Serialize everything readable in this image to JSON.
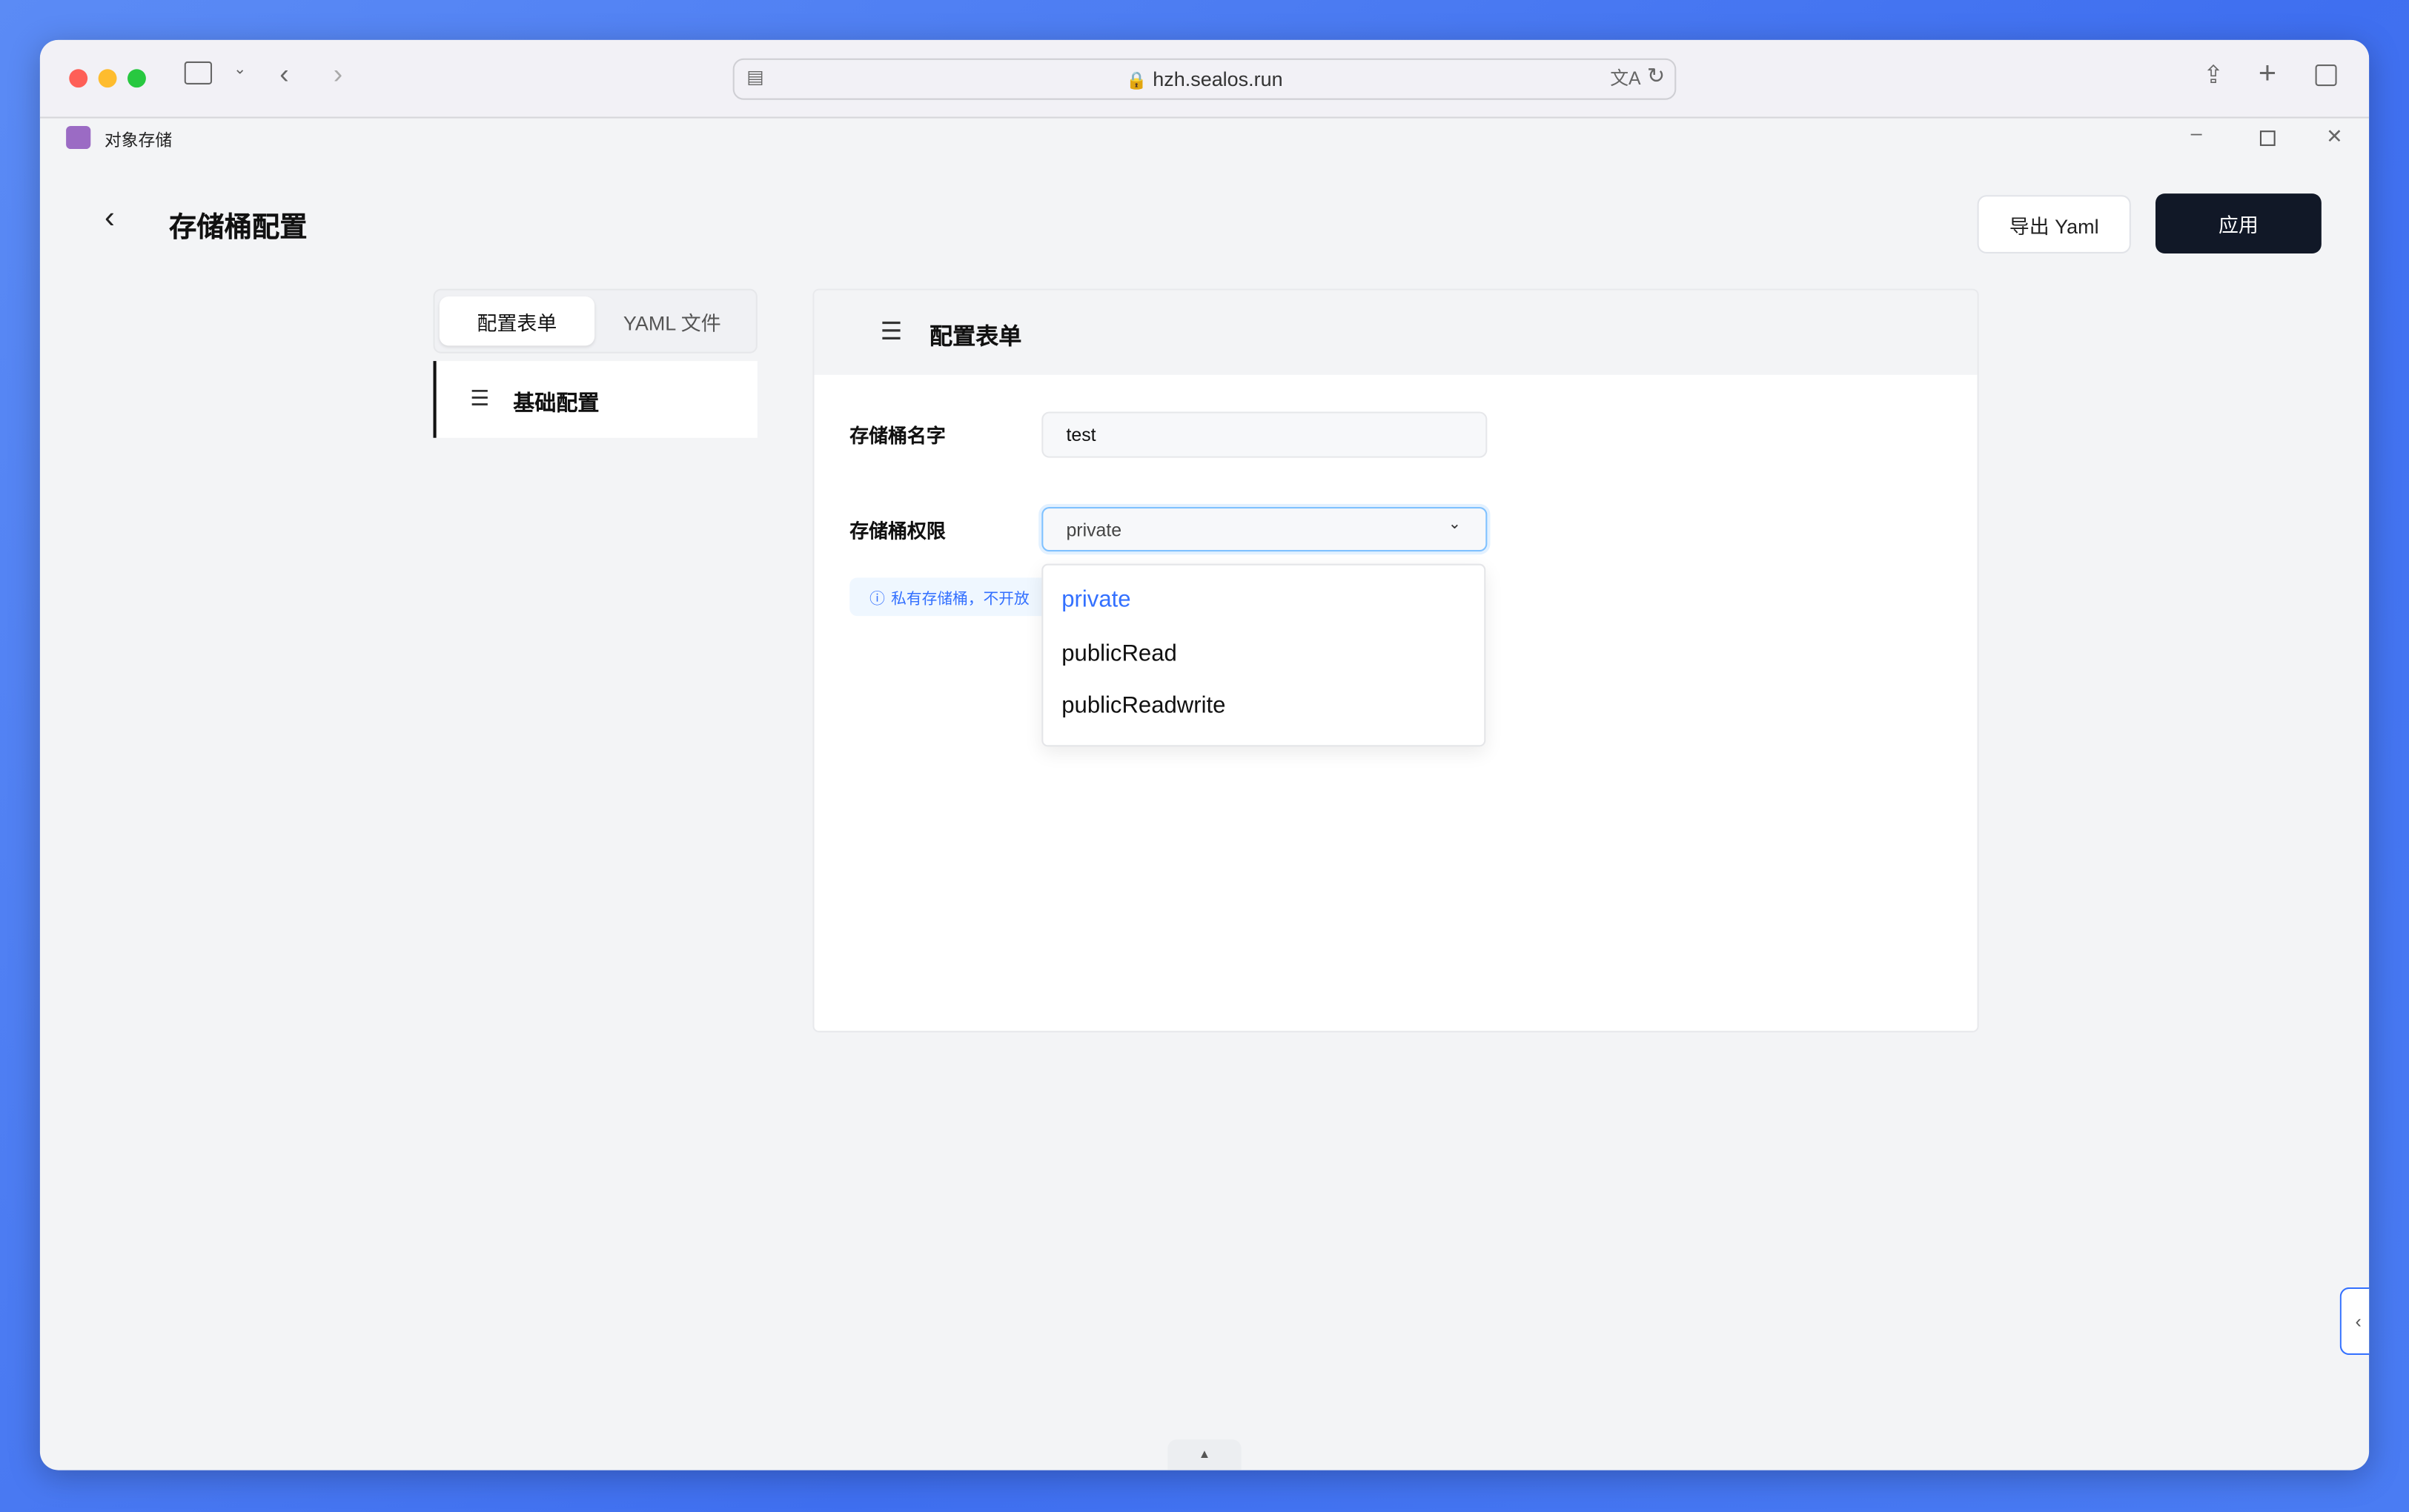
{
  "browser": {
    "url": "hzh.sealos.run",
    "icons": [
      "sidebar-icon",
      "chevron-down-icon",
      "back-icon",
      "forward-icon",
      "page-icon",
      "lock-icon",
      "translate-icon",
      "reload-icon",
      "share-icon",
      "new-tab-icon",
      "tabs-overview-icon"
    ]
  },
  "app": {
    "title": "对象存储",
    "icon": "storage-icon",
    "window_controls": [
      "minimize",
      "restore",
      "close"
    ]
  },
  "header": {
    "title": "存储桶配置",
    "export_label": "导出 Yaml",
    "apply_label": "应用"
  },
  "tabs": [
    {
      "label": "配置表单",
      "active": true
    },
    {
      "label": "YAML 文件",
      "active": false
    }
  ],
  "sidebar": {
    "items": [
      {
        "label": "基础配置",
        "icon": "list-icon"
      }
    ]
  },
  "form": {
    "title": "配置表单",
    "name_label": "存储桶名字",
    "name_value": "test",
    "perm_label": "存储桶权限",
    "perm_value": "private",
    "tip": "私有存储桶，不开放",
    "options": [
      "private",
      "publicRead",
      "publicReadwrite"
    ],
    "selected": "private"
  },
  "colors": {
    "accent": "#3370ff",
    "primary_button": "#111827",
    "focus_border": "#7fc1ff"
  }
}
